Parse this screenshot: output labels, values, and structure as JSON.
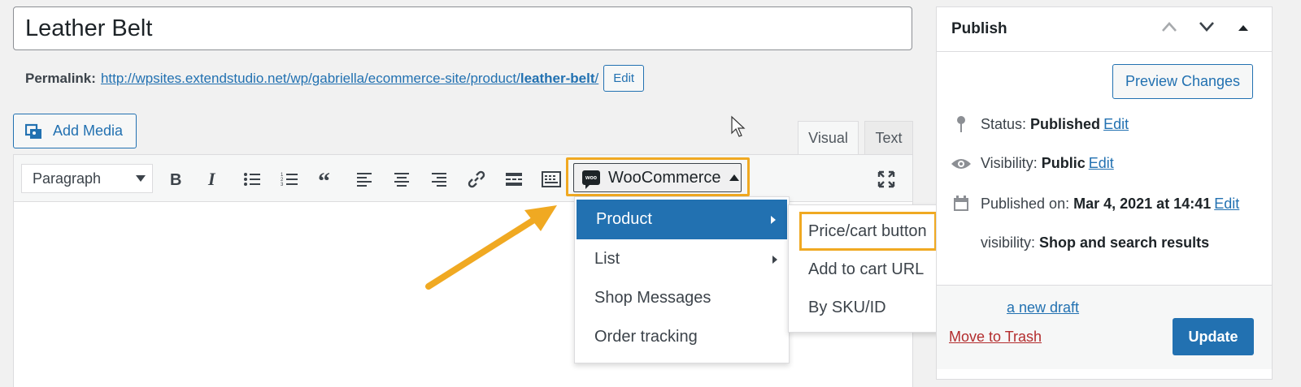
{
  "post": {
    "title": "Leather Belt",
    "permalink_label": "Permalink:",
    "permalink_base": "http://wpsites.extendstudio.net/wp/gabriella/ecommerce-site/product/",
    "permalink_slug": "leather-belt",
    "permalink_end": "/",
    "edit_label": "Edit"
  },
  "media": {
    "add_media_label": "Add Media"
  },
  "editor_tabs": {
    "visual": "Visual",
    "text": "Text",
    "active": "Visual"
  },
  "toolbar": {
    "format_select": "Paragraph",
    "buttons": [
      "bold-icon",
      "italic-icon",
      "bullet-list-icon",
      "numbered-list-icon",
      "blockquote-icon",
      "align-left-icon",
      "align-center-icon",
      "align-right-icon",
      "link-icon",
      "read-more-icon",
      "toolbar-toggle-icon"
    ],
    "woocommerce_label": "WooCommerce"
  },
  "woo_menu": {
    "items": [
      {
        "label": "Product",
        "has_submenu": true,
        "active": true
      },
      {
        "label": "List",
        "has_submenu": true,
        "active": false
      },
      {
        "label": "Shop Messages",
        "has_submenu": false,
        "active": false
      },
      {
        "label": "Order tracking",
        "has_submenu": false,
        "active": false
      }
    ],
    "product_submenu": [
      "Price/cart button",
      "Add to cart URL",
      "By SKU/ID"
    ],
    "highlighted": "Price/cart button"
  },
  "publish": {
    "title": "Publish",
    "preview_label": "Preview Changes",
    "status_label": "Status:",
    "status_value": "Published",
    "visibility_label": "Visibility:",
    "visibility_value": "Public",
    "published_label": "Published on:",
    "published_value": "Mar 4, 2021 at 14:41",
    "catalog_label": "visibility:",
    "catalog_value": "Shop and search results",
    "edit_label": "Edit",
    "draft_label": "a new draft",
    "trash_label": "Move to Trash",
    "update_label": "Update"
  },
  "colors": {
    "accent": "#2271b1",
    "highlight": "#f0a922",
    "trash": "#b32d2e"
  }
}
